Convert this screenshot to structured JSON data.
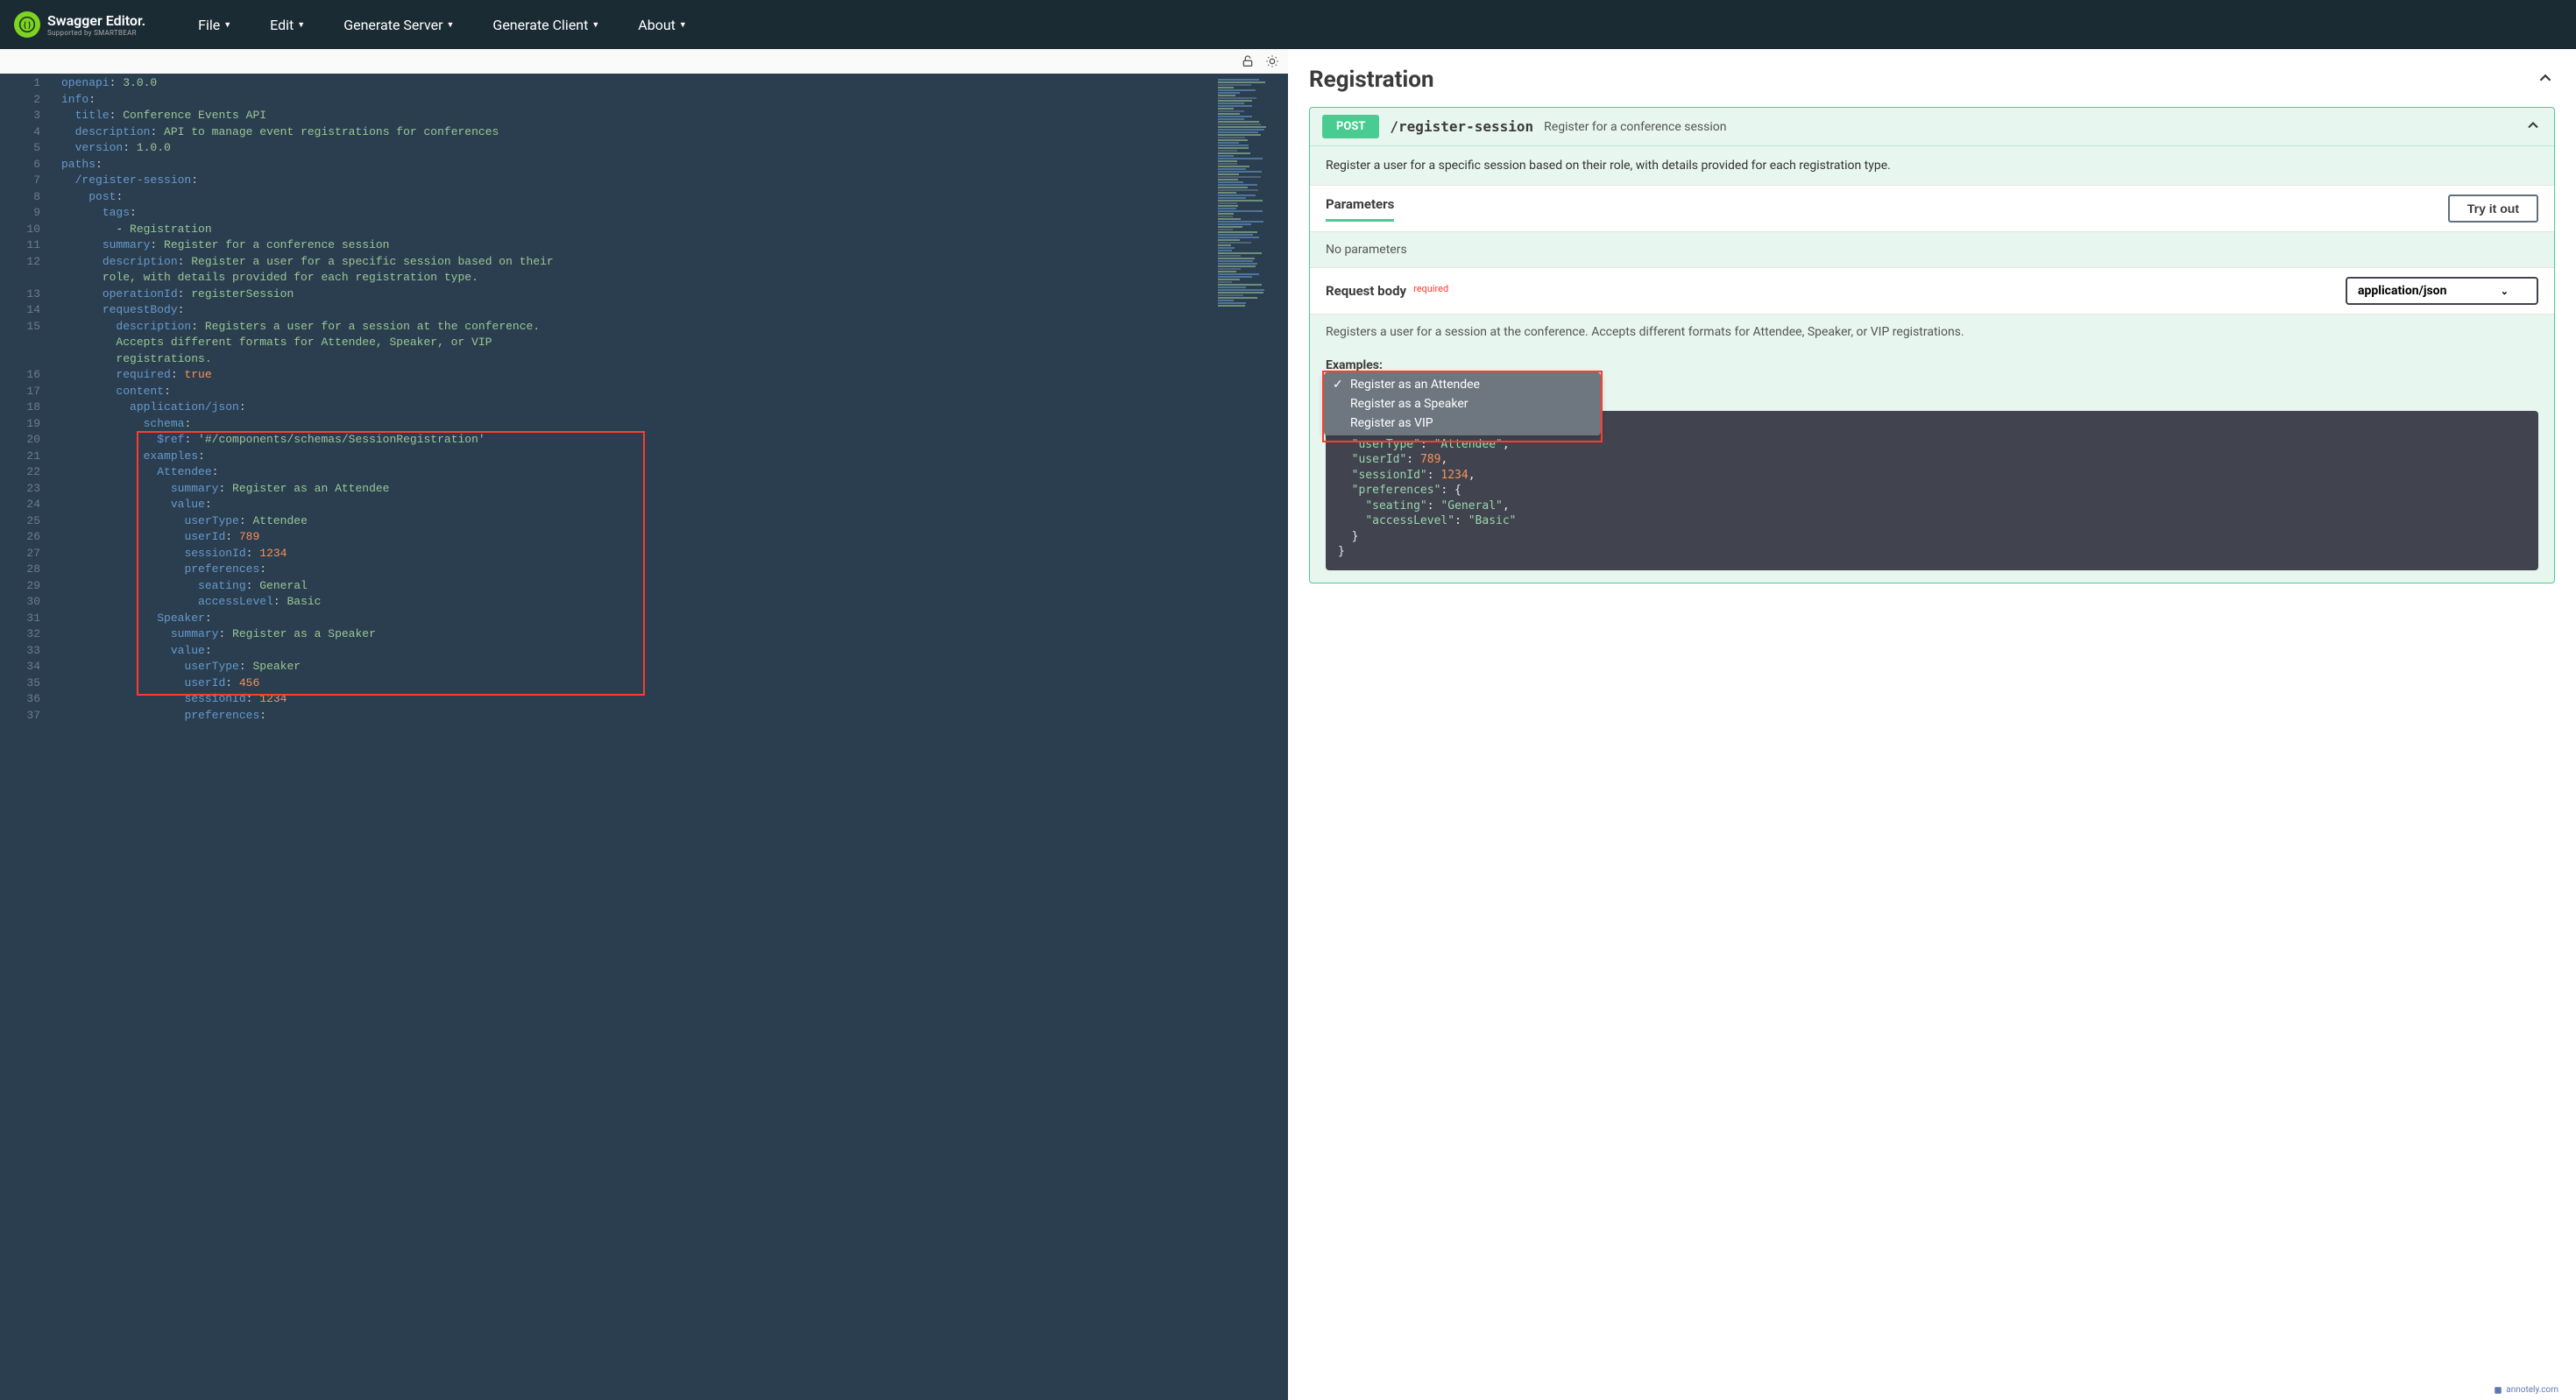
{
  "brand": {
    "name": "Swagger Editor.",
    "byline": "Supported by SMARTBEAR"
  },
  "menu": {
    "file": "File",
    "edit": "Edit",
    "genServer": "Generate Server",
    "genClient": "Generate Client",
    "about": "About"
  },
  "editor": {
    "lines": [
      {
        "n": "1",
        "tokens": [
          [
            "key",
            "openapi"
          ],
          [
            "punc",
            ": "
          ],
          [
            "str",
            "3.0.0"
          ]
        ]
      },
      {
        "n": "2",
        "tokens": [
          [
            "key",
            "info"
          ],
          [
            "punc",
            ":"
          ]
        ]
      },
      {
        "n": "3",
        "tokens": [
          [
            "punc",
            "  "
          ],
          [
            "key",
            "title"
          ],
          [
            "punc",
            ": "
          ],
          [
            "str",
            "Conference Events API"
          ]
        ]
      },
      {
        "n": "4",
        "tokens": [
          [
            "punc",
            "  "
          ],
          [
            "key",
            "description"
          ],
          [
            "punc",
            ": "
          ],
          [
            "str",
            "API to manage event registrations for conferences"
          ]
        ]
      },
      {
        "n": "5",
        "tokens": [
          [
            "punc",
            "  "
          ],
          [
            "key",
            "version"
          ],
          [
            "punc",
            ": "
          ],
          [
            "str",
            "1.0.0"
          ]
        ]
      },
      {
        "n": "6",
        "tokens": [
          [
            "key",
            "paths"
          ],
          [
            "punc",
            ":"
          ]
        ]
      },
      {
        "n": "7",
        "tokens": [
          [
            "punc",
            "  "
          ],
          [
            "key",
            "/register-session"
          ],
          [
            "punc",
            ":"
          ]
        ]
      },
      {
        "n": "8",
        "tokens": [
          [
            "punc",
            "    "
          ],
          [
            "key",
            "post"
          ],
          [
            "punc",
            ":"
          ]
        ]
      },
      {
        "n": "9",
        "tokens": [
          [
            "punc",
            "      "
          ],
          [
            "key",
            "tags"
          ],
          [
            "punc",
            ":"
          ]
        ]
      },
      {
        "n": "10",
        "tokens": [
          [
            "punc",
            "        - "
          ],
          [
            "str",
            "Registration"
          ]
        ]
      },
      {
        "n": "11",
        "tokens": [
          [
            "punc",
            "      "
          ],
          [
            "key",
            "summary"
          ],
          [
            "punc",
            ": "
          ],
          [
            "str",
            "Register for a conference session"
          ]
        ]
      },
      {
        "n": "12",
        "tokens": [
          [
            "punc",
            "      "
          ],
          [
            "key",
            "description"
          ],
          [
            "punc",
            ": "
          ],
          [
            "str",
            "Register a user for a specific session based on their "
          ]
        ]
      },
      {
        "n": "",
        "tokens": [
          [
            "punc",
            "      "
          ],
          [
            "str",
            "role, with details provided for each registration type."
          ]
        ]
      },
      {
        "n": "13",
        "tokens": [
          [
            "punc",
            "      "
          ],
          [
            "key",
            "operationId"
          ],
          [
            "punc",
            ": "
          ],
          [
            "str",
            "registerSession"
          ]
        ]
      },
      {
        "n": "14",
        "tokens": [
          [
            "punc",
            "      "
          ],
          [
            "key",
            "requestBody"
          ],
          [
            "punc",
            ":"
          ]
        ]
      },
      {
        "n": "15",
        "tokens": [
          [
            "punc",
            "        "
          ],
          [
            "key",
            "description"
          ],
          [
            "punc",
            ": "
          ],
          [
            "str",
            "Registers a user for a session at the conference. "
          ]
        ]
      },
      {
        "n": "",
        "tokens": [
          [
            "punc",
            "        "
          ],
          [
            "str",
            "Accepts different formats for Attendee, Speaker, or VIP "
          ]
        ]
      },
      {
        "n": "",
        "tokens": [
          [
            "punc",
            "        "
          ],
          [
            "str",
            "registrations."
          ]
        ]
      },
      {
        "n": "16",
        "tokens": [
          [
            "punc",
            "        "
          ],
          [
            "key",
            "required"
          ],
          [
            "punc",
            ": "
          ],
          [
            "bool",
            "true"
          ]
        ]
      },
      {
        "n": "17",
        "tokens": [
          [
            "punc",
            "        "
          ],
          [
            "key",
            "content"
          ],
          [
            "punc",
            ":"
          ]
        ]
      },
      {
        "n": "18",
        "tokens": [
          [
            "punc",
            "          "
          ],
          [
            "key",
            "application/json"
          ],
          [
            "punc",
            ":"
          ]
        ]
      },
      {
        "n": "19",
        "tokens": [
          [
            "punc",
            "            "
          ],
          [
            "key",
            "schema"
          ],
          [
            "punc",
            ":"
          ]
        ]
      },
      {
        "n": "20",
        "tokens": [
          [
            "punc",
            "              "
          ],
          [
            "key",
            "$ref"
          ],
          [
            "punc",
            ": "
          ],
          [
            "str",
            "'#/components/schemas/SessionRegistration'"
          ]
        ]
      },
      {
        "n": "21",
        "tokens": [
          [
            "punc",
            "            "
          ],
          [
            "key",
            "examples"
          ],
          [
            "punc",
            ":"
          ]
        ]
      },
      {
        "n": "22",
        "tokens": [
          [
            "punc",
            "              "
          ],
          [
            "key",
            "Attendee"
          ],
          [
            "punc",
            ":"
          ]
        ]
      },
      {
        "n": "23",
        "tokens": [
          [
            "punc",
            "                "
          ],
          [
            "key",
            "summary"
          ],
          [
            "punc",
            ": "
          ],
          [
            "str",
            "Register as an Attendee"
          ]
        ]
      },
      {
        "n": "24",
        "tokens": [
          [
            "punc",
            "                "
          ],
          [
            "key",
            "value"
          ],
          [
            "punc",
            ":"
          ]
        ]
      },
      {
        "n": "25",
        "tokens": [
          [
            "punc",
            "                  "
          ],
          [
            "key",
            "userType"
          ],
          [
            "punc",
            ": "
          ],
          [
            "str",
            "Attendee"
          ]
        ]
      },
      {
        "n": "26",
        "tokens": [
          [
            "punc",
            "                  "
          ],
          [
            "key",
            "userId"
          ],
          [
            "punc",
            ": "
          ],
          [
            "num",
            "789"
          ]
        ]
      },
      {
        "n": "27",
        "tokens": [
          [
            "punc",
            "                  "
          ],
          [
            "key",
            "sessionId"
          ],
          [
            "punc",
            ": "
          ],
          [
            "num",
            "1234"
          ]
        ]
      },
      {
        "n": "28",
        "tokens": [
          [
            "punc",
            "                  "
          ],
          [
            "key",
            "preferences"
          ],
          [
            "punc",
            ":"
          ]
        ]
      },
      {
        "n": "29",
        "tokens": [
          [
            "punc",
            "                    "
          ],
          [
            "key",
            "seating"
          ],
          [
            "punc",
            ": "
          ],
          [
            "str",
            "General"
          ]
        ]
      },
      {
        "n": "30",
        "tokens": [
          [
            "punc",
            "                    "
          ],
          [
            "key",
            "accessLevel"
          ],
          [
            "punc",
            ": "
          ],
          [
            "str",
            "Basic"
          ]
        ]
      },
      {
        "n": "31",
        "tokens": [
          [
            "punc",
            "              "
          ],
          [
            "key",
            "Speaker"
          ],
          [
            "punc",
            ":"
          ]
        ]
      },
      {
        "n": "32",
        "tokens": [
          [
            "punc",
            "                "
          ],
          [
            "key",
            "summary"
          ],
          [
            "punc",
            ": "
          ],
          [
            "str",
            "Register as a Speaker"
          ]
        ]
      },
      {
        "n": "33",
        "tokens": [
          [
            "punc",
            "                "
          ],
          [
            "key",
            "value"
          ],
          [
            "punc",
            ":"
          ]
        ]
      },
      {
        "n": "34",
        "tokens": [
          [
            "punc",
            "                  "
          ],
          [
            "key",
            "userType"
          ],
          [
            "punc",
            ": "
          ],
          [
            "str",
            "Speaker"
          ]
        ]
      },
      {
        "n": "35",
        "tokens": [
          [
            "punc",
            "                  "
          ],
          [
            "key",
            "userId"
          ],
          [
            "punc",
            ": "
          ],
          [
            "num",
            "456"
          ]
        ]
      },
      {
        "n": "36",
        "tokens": [
          [
            "punc",
            "                  "
          ],
          [
            "key",
            "sessionId"
          ],
          [
            "punc",
            ": "
          ],
          [
            "num",
            "1234"
          ]
        ]
      },
      {
        "n": "37",
        "tokens": [
          [
            "punc",
            "                  "
          ],
          [
            "key",
            "preferences"
          ],
          [
            "punc",
            ":"
          ]
        ]
      }
    ]
  },
  "docs": {
    "tag": "Registration",
    "operation": {
      "method": "POST",
      "path": "/register-session",
      "summary": "Register for a conference session",
      "description": "Register a user for a specific session based on their role, with details provided for each registration type."
    },
    "paramsTitle": "Parameters",
    "tryIt": "Try it out",
    "noParams": "No parameters",
    "reqBodyTitle": "Request body",
    "requiredTag": "required",
    "mime": "application/json",
    "reqBodyDesc": "Registers a user for a session at the conference. Accepts different formats for Attendee, Speaker, or VIP registrations.",
    "examplesLabel": "Examples:",
    "examples": [
      "Register as an Attendee",
      "Register as a Speaker",
      "Register as VIP"
    ],
    "sample": "{\n  \"userType\": \"Attendee\",\n  \"userId\": 789,\n  \"sessionId\": 1234,\n  \"preferences\": {\n    \"seating\": \"General\",\n    \"accessLevel\": \"Basic\"\n  }\n}"
  },
  "watermark": "annotely.com"
}
